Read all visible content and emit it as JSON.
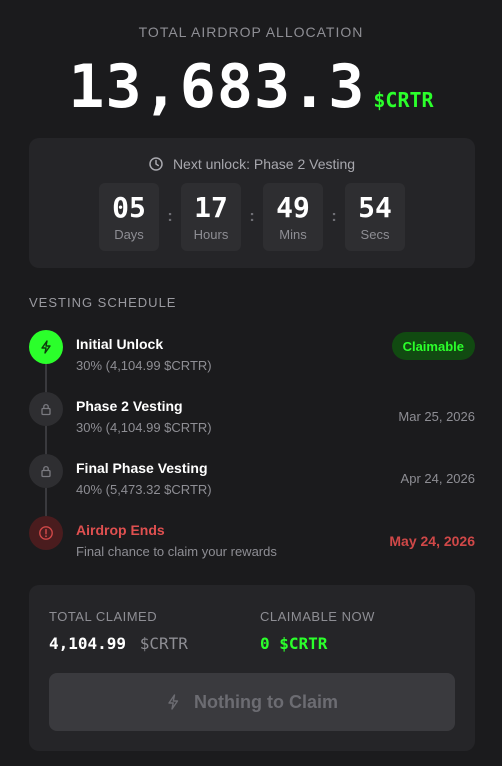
{
  "header": {
    "label": "TOTAL AIRDROP ALLOCATION",
    "amount": "13,683.3",
    "token": "$CRTR"
  },
  "countdown": {
    "next_unlock": "Next unlock: Phase 2 Vesting",
    "units": [
      {
        "value": "05",
        "label": "Days"
      },
      {
        "value": "17",
        "label": "Hours"
      },
      {
        "value": "49",
        "label": "Mins"
      },
      {
        "value": "54",
        "label": "Secs"
      }
    ]
  },
  "schedule": {
    "title": "VESTING SCHEDULE",
    "milestones": [
      {
        "title": "Initial Unlock",
        "detail": "30% (4,104.99 $CRTR)",
        "status": "Claimable",
        "icon": "bolt-icon"
      },
      {
        "title": "Phase 2 Vesting",
        "detail": "30% (4,104.99 $CRTR)",
        "date": "Mar 25, 2026",
        "icon": "lock-icon"
      },
      {
        "title": "Final Phase Vesting",
        "detail": "40% (5,473.32 $CRTR)",
        "date": "Apr 24, 2026",
        "icon": "lock-icon"
      },
      {
        "title": "Airdrop Ends",
        "detail": "Final chance to claim your rewards",
        "date": "May 24, 2026",
        "icon": "alert-circle-icon"
      }
    ]
  },
  "summary": {
    "claimed_label": "TOTAL CLAIMED",
    "claimed_amount": "4,104.99",
    "claimed_token": "$CRTR",
    "claimable_label": "CLAIMABLE NOW",
    "claimable_value": "0 $CRTR",
    "button_label": "Nothing to Claim"
  },
  "colors": {
    "accent_green": "#2bff2b",
    "danger_red": "#e05050",
    "background": "#1b1b1d"
  }
}
